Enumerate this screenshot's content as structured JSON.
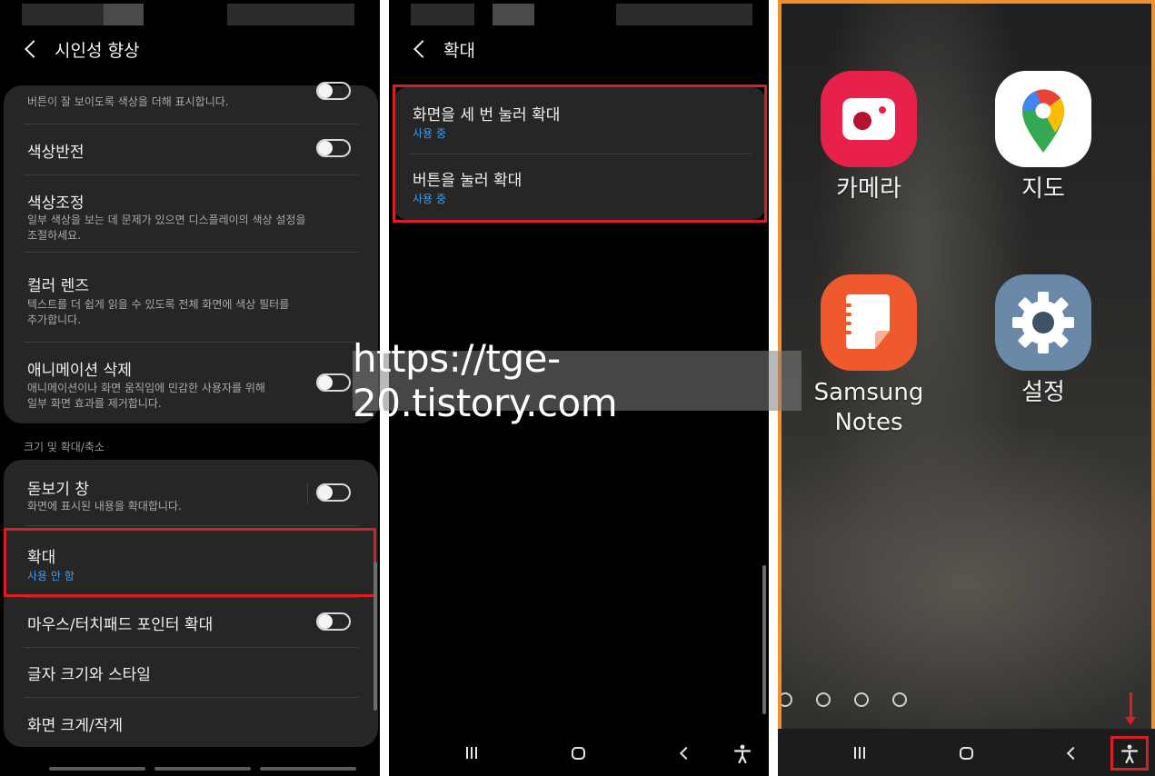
{
  "panel1": {
    "title": "시인성 향상",
    "card1": {
      "partial_sub": "버튼이 잘 보이도록 색상을 더해 표시합니다.",
      "items": [
        {
          "title": "색상반전",
          "sub": "",
          "toggle": false
        },
        {
          "title": "색상조정",
          "sub": "일부 색상을 보는 데 문제가 있으면 디스플레이의 색상 설정을\n조절하세요."
        },
        {
          "title": "컬러 렌즈",
          "sub": "텍스트를 더 쉽게 읽을 수 있도록 전체 화면에 색상 필터를\n추가합니다."
        },
        {
          "title": "애니메이션 삭제",
          "sub": "애니메이션이나 화면 움직임에 민감한 사용자를 위해\n일부 화면 효과를 제거합니다.",
          "toggle": false
        }
      ]
    },
    "section_label": "크기 및 확대/축소",
    "card2": {
      "items": [
        {
          "title": "돋보기 창",
          "sub": "화면에 표시된 내용을 확대합니다.",
          "toggle": false
        },
        {
          "title": "확대",
          "status": "사용 안 함"
        },
        {
          "title": "마우스/터치패드 포인터 확대",
          "toggle": false
        },
        {
          "title": "글자 크기와 스타일"
        },
        {
          "title": "화면 크게/작게"
        }
      ]
    }
  },
  "panel2": {
    "title": "확대",
    "items": [
      {
        "title": "화면을 세 번 눌러 확대",
        "status": "사용 중"
      },
      {
        "title": "버튼을 눌러 확대",
        "status": "사용 중"
      }
    ]
  },
  "panel3": {
    "apps": [
      {
        "label": "카메라",
        "icon": "camera-icon",
        "color": "#e8214a"
      },
      {
        "label": "지도",
        "icon": "google-maps-icon",
        "color": "#ffffff"
      },
      {
        "label": "Samsung\nNotes",
        "icon": "samsung-notes-icon",
        "color": "#ee5a2e"
      },
      {
        "label": "설정",
        "icon": "settings-gear-icon",
        "color": "#6a88a8"
      }
    ],
    "page_dots": 4
  },
  "watermark": "https://tge-20.tistory.com",
  "colors": {
    "highlight_red": "#d81f26",
    "highlight_orange": "#f28e2b",
    "status_blue": "#3f9cf0",
    "card_bg": "#262626"
  }
}
